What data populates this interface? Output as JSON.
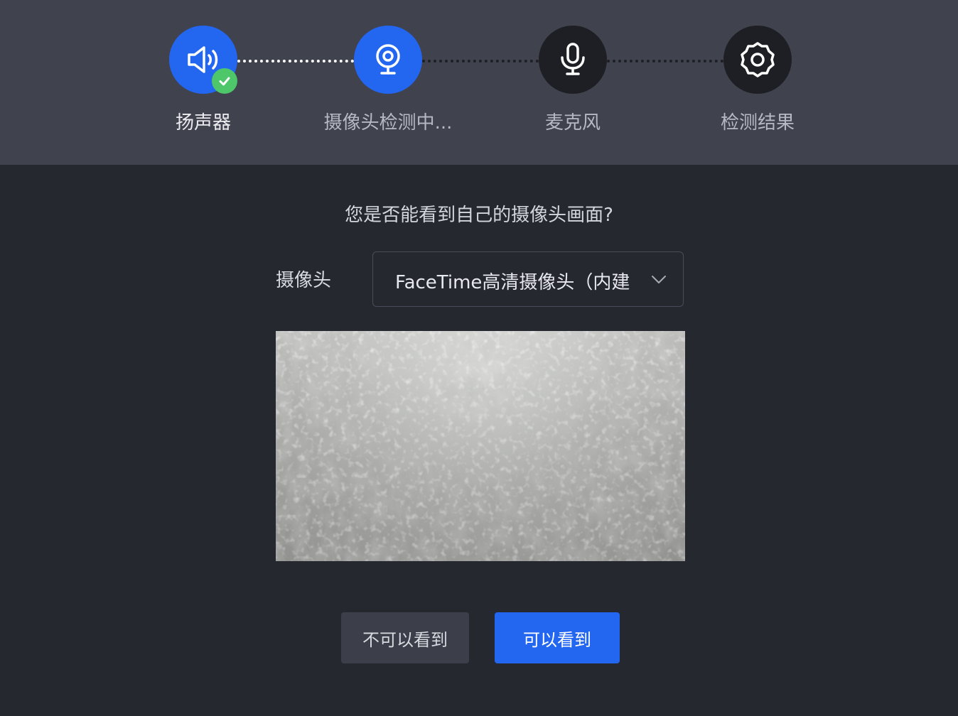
{
  "steps": [
    {
      "label": "扬声器",
      "icon": "speaker-icon",
      "status": "done"
    },
    {
      "label": "摄像头检测中...",
      "icon": "webcam-icon",
      "status": "active"
    },
    {
      "label": "麦克风",
      "icon": "microphone-icon",
      "status": "pending"
    },
    {
      "label": "检测结果",
      "icon": "gear-icon",
      "status": "pending"
    }
  ],
  "question": "您是否能看到自己的摄像头画面?",
  "camera": {
    "label": "摄像头",
    "selected": "FaceTime高清摄像头（内建"
  },
  "buttons": {
    "cannot_see": "不可以看到",
    "can_see": "可以看到"
  },
  "colors": {
    "accent": "#2366f0",
    "success": "#4ec66a",
    "header_bg": "#40424e",
    "page_bg": "#262830"
  }
}
